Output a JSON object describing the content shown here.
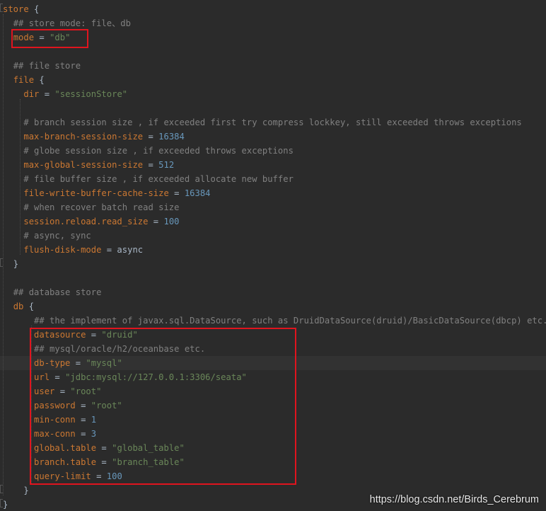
{
  "colors": {
    "background": "#2b2b2b",
    "key": "#cc7832",
    "string": "#6a8759",
    "number": "#6897bb",
    "comment": "#808080",
    "plain": "#a9b7c6",
    "highlight_box": "#e0141e"
  },
  "code_lines": [
    {
      "indent": "",
      "segments": [
        {
          "t": "key",
          "v": "store"
        },
        {
          "t": "pun",
          "v": " {"
        }
      ]
    },
    {
      "indent": "  ",
      "segments": [
        {
          "t": "com",
          "v": "## store mode: file、db"
        }
      ]
    },
    {
      "indent": "  ",
      "segments": [
        {
          "t": "key",
          "v": "mode"
        },
        {
          "t": "pun",
          "v": " = "
        },
        {
          "t": "str",
          "v": "\"db\""
        }
      ]
    },
    {
      "indent": "",
      "segments": []
    },
    {
      "indent": "  ",
      "segments": [
        {
          "t": "com",
          "v": "## file store"
        }
      ]
    },
    {
      "indent": "  ",
      "segments": [
        {
          "t": "key",
          "v": "file"
        },
        {
          "t": "pun",
          "v": " {"
        }
      ]
    },
    {
      "indent": "    ",
      "segments": [
        {
          "t": "key",
          "v": "dir"
        },
        {
          "t": "pun",
          "v": " = "
        },
        {
          "t": "str",
          "v": "\"sessionStore\""
        }
      ]
    },
    {
      "indent": "",
      "segments": []
    },
    {
      "indent": "    ",
      "segments": [
        {
          "t": "com",
          "v": "# branch session size , if exceeded first try compress lockkey, still exceeded throws exceptions"
        }
      ]
    },
    {
      "indent": "    ",
      "segments": [
        {
          "t": "key",
          "v": "max-branch-session-size"
        },
        {
          "t": "pun",
          "v": " = "
        },
        {
          "t": "num",
          "v": "16384"
        }
      ]
    },
    {
      "indent": "    ",
      "segments": [
        {
          "t": "com",
          "v": "# globe session size , if exceeded throws exceptions"
        }
      ]
    },
    {
      "indent": "    ",
      "segments": [
        {
          "t": "key",
          "v": "max-global-session-size"
        },
        {
          "t": "pun",
          "v": " = "
        },
        {
          "t": "num",
          "v": "512"
        }
      ]
    },
    {
      "indent": "    ",
      "segments": [
        {
          "t": "com",
          "v": "# file buffer size , if exceeded allocate new buffer"
        }
      ]
    },
    {
      "indent": "    ",
      "segments": [
        {
          "t": "key",
          "v": "file-write-buffer-cache-size"
        },
        {
          "t": "pun",
          "v": " = "
        },
        {
          "t": "num",
          "v": "16384"
        }
      ]
    },
    {
      "indent": "    ",
      "segments": [
        {
          "t": "com",
          "v": "# when recover batch read size"
        }
      ]
    },
    {
      "indent": "    ",
      "segments": [
        {
          "t": "key",
          "v": "session.reload.read_size"
        },
        {
          "t": "pun",
          "v": " = "
        },
        {
          "t": "num",
          "v": "100"
        }
      ]
    },
    {
      "indent": "    ",
      "segments": [
        {
          "t": "com",
          "v": "# async, sync"
        }
      ]
    },
    {
      "indent": "    ",
      "segments": [
        {
          "t": "key",
          "v": "flush-disk-mode"
        },
        {
          "t": "pun",
          "v": " = async"
        }
      ]
    },
    {
      "indent": "  ",
      "segments": [
        {
          "t": "pun",
          "v": "}"
        }
      ]
    },
    {
      "indent": "",
      "segments": []
    },
    {
      "indent": "  ",
      "segments": [
        {
          "t": "com",
          "v": "## database store"
        }
      ]
    },
    {
      "indent": "  ",
      "segments": [
        {
          "t": "key",
          "v": "db"
        },
        {
          "t": "pun",
          "v": " {"
        }
      ]
    },
    {
      "indent": "      ",
      "segments": [
        {
          "t": "com",
          "v": "## the implement of javax.sql.DataSource, such as DruidDataSource(druid)/BasicDataSource(dbcp) etc."
        }
      ]
    },
    {
      "indent": "      ",
      "segments": [
        {
          "t": "key",
          "v": "datasource"
        },
        {
          "t": "pun",
          "v": " = "
        },
        {
          "t": "str",
          "v": "\"druid\""
        }
      ]
    },
    {
      "indent": "      ",
      "segments": [
        {
          "t": "com",
          "v": "## mysql/oracle/h2/oceanbase etc."
        }
      ]
    },
    {
      "indent": "      ",
      "current": true,
      "segments": [
        {
          "t": "key",
          "v": "db-type"
        },
        {
          "t": "pun",
          "v": " = "
        },
        {
          "t": "str",
          "v": "\"mysql\""
        }
      ]
    },
    {
      "indent": "      ",
      "segments": [
        {
          "t": "key",
          "v": "url"
        },
        {
          "t": "pun",
          "v": " = "
        },
        {
          "t": "str",
          "v": "\"jdbc:mysql://127.0.0.1:3306/seata\""
        }
      ]
    },
    {
      "indent": "      ",
      "segments": [
        {
          "t": "key",
          "v": "user"
        },
        {
          "t": "pun",
          "v": " = "
        },
        {
          "t": "str",
          "v": "\"root\""
        }
      ]
    },
    {
      "indent": "      ",
      "segments": [
        {
          "t": "key",
          "v": "password"
        },
        {
          "t": "pun",
          "v": " = "
        },
        {
          "t": "str",
          "v": "\"root\""
        }
      ]
    },
    {
      "indent": "      ",
      "segments": [
        {
          "t": "key",
          "v": "min-conn"
        },
        {
          "t": "pun",
          "v": " = "
        },
        {
          "t": "num",
          "v": "1"
        }
      ]
    },
    {
      "indent": "      ",
      "segments": [
        {
          "t": "key",
          "v": "max-conn"
        },
        {
          "t": "pun",
          "v": " = "
        },
        {
          "t": "num",
          "v": "3"
        }
      ]
    },
    {
      "indent": "      ",
      "segments": [
        {
          "t": "key",
          "v": "global.table"
        },
        {
          "t": "pun",
          "v": " = "
        },
        {
          "t": "str",
          "v": "\"global_table\""
        }
      ]
    },
    {
      "indent": "      ",
      "segments": [
        {
          "t": "key",
          "v": "branch.table"
        },
        {
          "t": "pun",
          "v": " = "
        },
        {
          "t": "str",
          "v": "\"branch_table\""
        }
      ]
    },
    {
      "indent": "      ",
      "segments": [
        {
          "t": "key",
          "v": "query-limit"
        },
        {
          "t": "pun",
          "v": " = "
        },
        {
          "t": "num",
          "v": "100"
        }
      ]
    },
    {
      "indent": "    ",
      "segments": [
        {
          "t": "pun",
          "v": "}"
        }
      ]
    },
    {
      "indent": "",
      "segments": [
        {
          "t": "pun",
          "v": "}"
        }
      ]
    }
  ],
  "watermark": "https://blog.csdn.net/Birds_Cerebrum"
}
